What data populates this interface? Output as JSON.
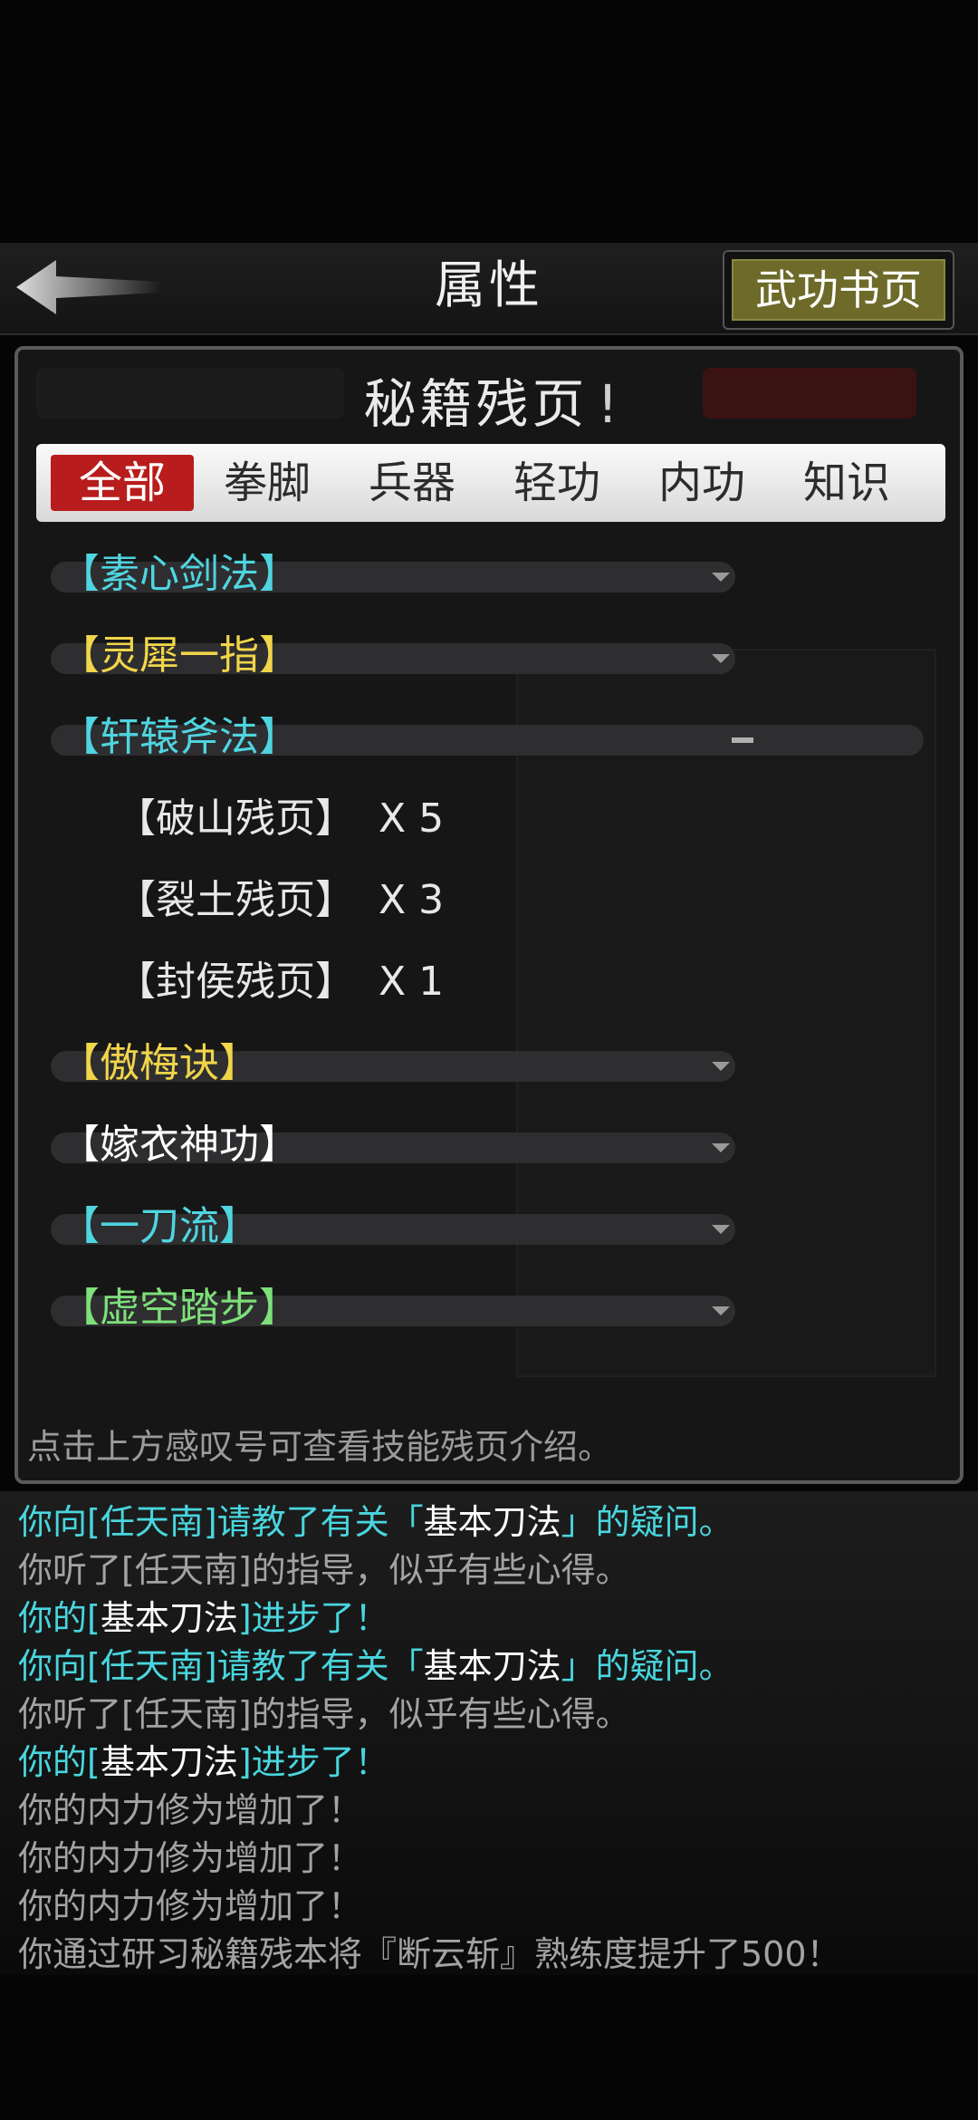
{
  "header": {
    "title": "属性",
    "wugong_button": "武功书页"
  },
  "secret_pages": {
    "title": "秘籍残页",
    "info_mark": "!",
    "tabs": [
      "全部",
      "拳脚",
      "兵器",
      "轻功",
      "内功",
      "知识"
    ],
    "active_tab": "全部",
    "items": [
      {
        "name": "【素心剑法】",
        "color": "#4fd5e0",
        "expanded": false
      },
      {
        "name": "【灵犀一指】",
        "color": "#f1d54a",
        "expanded": false
      },
      {
        "name": "【轩辕斧法】",
        "color": "#4fd5e0",
        "expanded": true,
        "pages": [
          {
            "name": "【破山残页】",
            "count": "X 5"
          },
          {
            "name": "【裂土残页】",
            "count": "X 3"
          },
          {
            "name": "【封侯残页】",
            "count": "X 1"
          }
        ]
      },
      {
        "name": "【傲梅诀】",
        "color": "#f1d54a",
        "expanded": false
      },
      {
        "name": "【嫁衣神功】",
        "color": "#ffffff",
        "expanded": false
      },
      {
        "name": "【一刀流】",
        "color": "#4fd5e0",
        "expanded": false
      },
      {
        "name": "【虚空踏步】",
        "color": "#7ee07a",
        "expanded": false
      }
    ],
    "hint": "点击上方感叹号可查看技能残页介绍。"
  },
  "log": [
    {
      "segments": [
        {
          "t": "你向[任天南]请教了有关「",
          "c": "cyan"
        },
        {
          "t": "基本刀法",
          "c": "white"
        },
        {
          "t": "」的疑问。",
          "c": "cyan"
        }
      ]
    },
    {
      "segments": [
        {
          "t": "你听了[任天南]的指导，似乎有些心得。",
          "c": "gray"
        }
      ]
    },
    {
      "segments": [
        {
          "t": "你的[",
          "c": "cyan"
        },
        {
          "t": "基本刀法",
          "c": "white"
        },
        {
          "t": "]进步了！",
          "c": "cyan"
        }
      ]
    },
    {
      "segments": [
        {
          "t": "你向[任天南]请教了有关「",
          "c": "cyan"
        },
        {
          "t": "基本刀法",
          "c": "white"
        },
        {
          "t": "」的疑问。",
          "c": "cyan"
        }
      ]
    },
    {
      "segments": [
        {
          "t": "你听了[任天南]的指导，似乎有些心得。",
          "c": "gray"
        }
      ]
    },
    {
      "segments": [
        {
          "t": "你的[",
          "c": "cyan"
        },
        {
          "t": "基本刀法",
          "c": "white"
        },
        {
          "t": "]进步了！",
          "c": "cyan"
        }
      ]
    },
    {
      "segments": [
        {
          "t": "你的内力修为增加了！",
          "c": "gray"
        }
      ]
    },
    {
      "segments": [
        {
          "t": "你的内力修为增加了！",
          "c": "gray"
        }
      ]
    },
    {
      "segments": [
        {
          "t": "你的内力修为增加了！",
          "c": "gray"
        }
      ]
    },
    {
      "segments": [
        {
          "t": "你通过研习秘籍残本将『断云斩』熟练度提升了500！",
          "c": "gray"
        }
      ]
    }
  ]
}
